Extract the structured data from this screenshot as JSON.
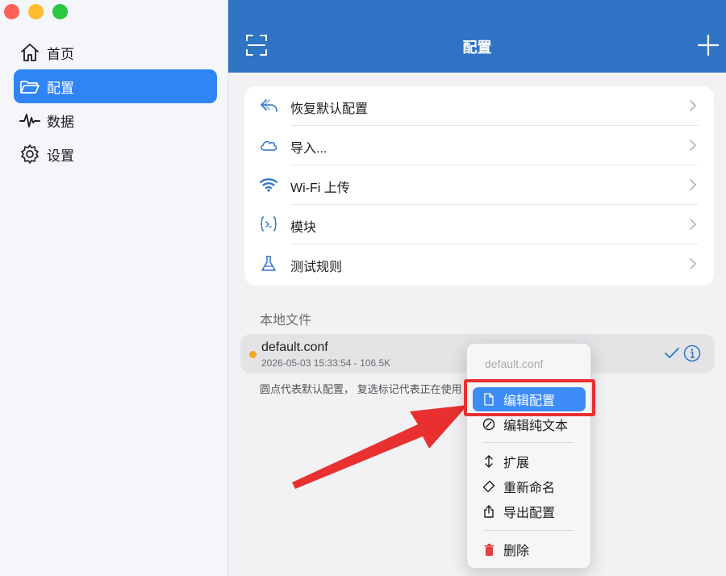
{
  "sidebar": {
    "items": [
      {
        "label": "首页",
        "icon": "home-icon"
      },
      {
        "label": "配置",
        "icon": "folder-icon",
        "active": true
      },
      {
        "label": "数据",
        "icon": "waveform-icon"
      },
      {
        "label": "设置",
        "icon": "gear-icon"
      }
    ]
  },
  "header": {
    "title": "配置",
    "left_icon": "scan-icon",
    "right_icon": "plus-icon",
    "color": "#2f73c4"
  },
  "actions": [
    {
      "label": "恢复默认配置",
      "icon": "undo-arrow-icon"
    },
    {
      "label": "导入...",
      "icon": "cloud-icon"
    },
    {
      "label": "Wi-Fi 上传",
      "icon": "wifi-icon"
    },
    {
      "label": "模块",
      "icon": "module-braces-icon"
    },
    {
      "label": "测试规则",
      "icon": "flask-icon"
    }
  ],
  "local_files": {
    "section_title": "本地文件",
    "files": [
      {
        "name": "default.conf",
        "meta": "2026-05-03 15:33:54 - 106.5K",
        "default": true,
        "selected": true
      }
    ],
    "hint": "圆点代表默认配置， 复选标记代表正在使用"
  },
  "context_menu": {
    "header": "default.conf",
    "items": [
      {
        "label": "编辑配置",
        "icon": "document-icon",
        "highlighted": true
      },
      {
        "label": "编辑纯文本",
        "icon": "slash-circle-icon"
      },
      {
        "label": "扩展",
        "icon": "expand-arrows-icon"
      },
      {
        "label": "重新命名",
        "icon": "tag-icon"
      },
      {
        "label": "导出配置",
        "icon": "share-icon"
      },
      {
        "label": "删除",
        "icon": "trash-icon",
        "destructive": true
      }
    ]
  },
  "colors": {
    "accent": "#2f84f6",
    "highlight": "#3d8cf7",
    "annotation": "#e83030",
    "danger": "#e04040"
  }
}
